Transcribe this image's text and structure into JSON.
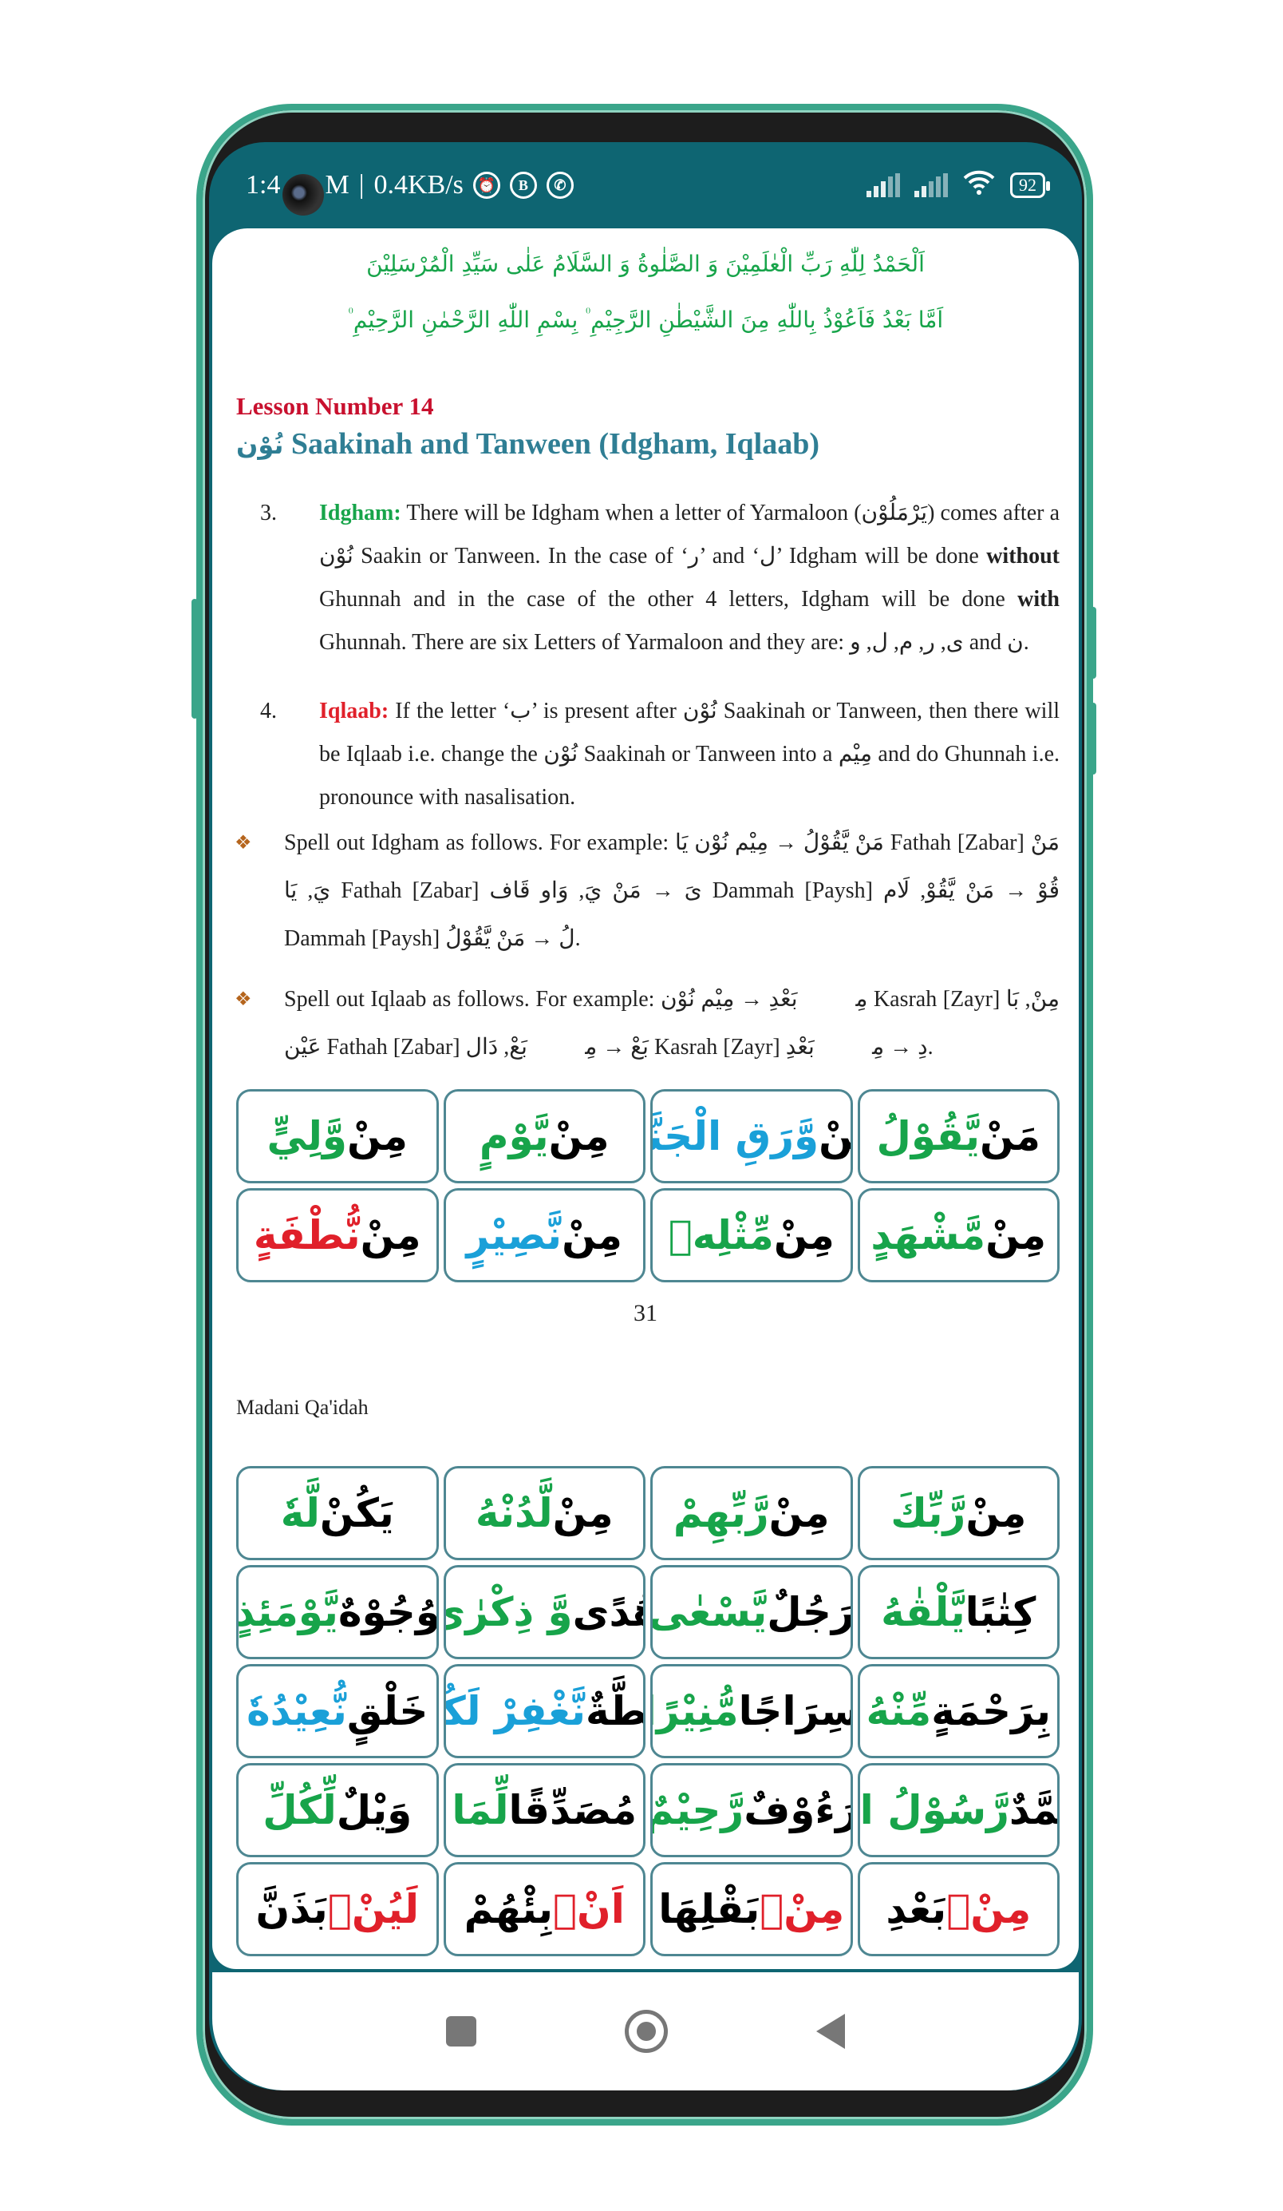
{
  "status_bar": {
    "time": "1:4",
    "time_suffix": "M",
    "net_speed": "0.4KB/s",
    "icons": [
      "alarm-icon",
      "b-icon",
      "whatsapp-icon",
      "signal-icon",
      "signal-icon",
      "wifi-icon"
    ],
    "battery": "92"
  },
  "header": {
    "bismillah_line1": "اَلْحَمْدُ لِلّٰهِ رَبِّ الْعٰلَمِيْنَ وَ الصَّلٰوةُ وَ السَّلَامُ عَلٰى سَيِّدِ الْمُرْسَلِيْنَ",
    "bismillah_line2": "اَمَّا بَعْدُ فَاَعُوْذُ بِاللّٰهِ مِنَ الشَّيْطٰنِ الرَّجِيْمِ ۠ بِسْمِ اللّٰهِ الرَّحْمٰنِ الرَّحِيْمِ ۠",
    "lesson": "Lesson Number 14",
    "title_ar": "نُوْن",
    "title": "Saakinah and Tanween (Idgham, Iqlaab)"
  },
  "paragraphs": [
    {
      "num": "3.",
      "term": "Idgham:",
      "text": "There will be Idgham when a letter of Yarmaloon (يَرْمَلُوْن) comes after a نُوْن Saakin or Tanween. In the case of ‘ر’ and ‘ل’ Idgham will be done <b>without</b> Ghunnah and in the case of the other 4 letters, Idgham will be done <b>with</b> Ghunnah. There are six Letters of Yarmaloon and they are: ی, ر, م, ل, و and ن."
    },
    {
      "num": "4.",
      "term": "Iqlaab:",
      "text": "If the letter ‘ب’ is present after نُوْن Saakinah or Tanween, then there will be Iqlaab i.e. change the نُوْن Saakinah or Tanween into a مِيْم and do Ghunnah i.e. pronounce with nasalisation."
    }
  ],
  "bullets": [
    {
      "text": "Spell out Idgham as follows. For example: مَنْ يَّقُوْلُ → مِيْم نُوْن يَا Fathah [Zabar] مَنْ يَ, يَا Fathah [Zabar] ىَ → مَنْ يَ, وَاو قَاف Dammah [Paysh] قُوْ → مَنْ يَّقُوْ, لَام Dammah [Paysh] لُ → مَنْ يَّقُوْلُ."
    },
    {
      "text": "Spell out Iqlaab as follows. For example: مِنْۢ بَعْدِ → مِيْم نُوْن Kasrah [Zayr] مِنْ, بَا عَيْن Fathah [Zabar] بَعْ → مِنْۢ بَعْ, دَال Kasrah [Zayr] دِ → مِنْۢ بَعْدِ."
    }
  ],
  "table1": [
    [
      {
        "t": "مَنْ ",
        "c": ""
      },
      {
        "t": "يَّقُوْلُ",
        "c": "#17a44a"
      }
    ],
    [
      {
        "t": "مِنْ ",
        "c": ""
      },
      {
        "t": "وَّرَقِ الْجَنَّةِ",
        "c": "#1aa0d8"
      }
    ],
    [
      {
        "t": "مِنْ ",
        "c": ""
      },
      {
        "t": "يَّوْمٍ",
        "c": "#17a44a"
      }
    ],
    [
      {
        "t": "مِنْ ",
        "c": ""
      },
      {
        "t": "وَّلِيٍّ",
        "c": "#17a44a"
      }
    ],
    [
      {
        "t": "مِنْ ",
        "c": ""
      },
      {
        "t": "مَّشْهَدٍ",
        "c": "#17a44a"
      }
    ],
    [
      {
        "t": "مِنْ ",
        "c": ""
      },
      {
        "t": "مِّثْلِهٖ",
        "c": "#17a44a"
      }
    ],
    [
      {
        "t": "مِنْ ",
        "c": ""
      },
      {
        "t": "نَّصِيْرٍ",
        "c": "#1aa0d8"
      }
    ],
    [
      {
        "t": "مِنْ ",
        "c": ""
      },
      {
        "t": "نُّطْفَةٍ",
        "c": "#e0202a"
      }
    ]
  ],
  "page_number": "31",
  "footer_label": "Madani Qa'idah",
  "table2": [
    [
      {
        "t": "مِنْ ",
        "c": ""
      },
      {
        "t": "رَّبِّكَ",
        "c": "#17a44a"
      }
    ],
    [
      {
        "t": "مِنْ ",
        "c": ""
      },
      {
        "t": "رَّبِّهِمْ",
        "c": "#17a44a"
      }
    ],
    [
      {
        "t": "مِنْ ",
        "c": ""
      },
      {
        "t": "لَّدُنْهُ",
        "c": "#17a44a"
      }
    ],
    [
      {
        "t": "يَكُنْ ",
        "c": ""
      },
      {
        "t": "لَّهٗ",
        "c": "#17a44a"
      }
    ],
    [
      {
        "t": "كِتٰبًا ",
        "c": ""
      },
      {
        "t": "يَّلْقٰهُ",
        "c": "#17a44a"
      }
    ],
    [
      {
        "t": "رَجُلٌ ",
        "c": ""
      },
      {
        "t": "يَّسْعٰى",
        "c": "#17a44a"
      }
    ],
    [
      {
        "t": "هُدًى ",
        "c": ""
      },
      {
        "t": "وَّ ذِكْرٰى",
        "c": "#17a44a"
      }
    ],
    [
      {
        "t": "وُجُوْهٌ ",
        "c": ""
      },
      {
        "t": "يَّوْمَئِذٍ",
        "c": "#17a44a"
      }
    ],
    [
      {
        "t": "بِرَحْمَةٍ ",
        "c": ""
      },
      {
        "t": "مِّنْهُ",
        "c": "#17a44a"
      }
    ],
    [
      {
        "t": "سِرَاجًا ",
        "c": ""
      },
      {
        "t": "مُّنِيْرًا",
        "c": "#17a44a"
      }
    ],
    [
      {
        "t": "حِطَّةٌ ",
        "c": ""
      },
      {
        "t": "نَّغْفِرْ لَكُمْ",
        "c": "#1aa0d8"
      }
    ],
    [
      {
        "t": "خَلْقٍ ",
        "c": ""
      },
      {
        "t": "نُّعِيْدُهٗ",
        "c": "#1aa0d8"
      }
    ],
    [
      {
        "t": "مُحَمَّدٌ ",
        "c": ""
      },
      {
        "t": "رَّسُوْلُ اللّٰهِ",
        "c": "#17a44a"
      }
    ],
    [
      {
        "t": "رَءُوْفٌ ",
        "c": ""
      },
      {
        "t": "رَّحِيْمٌ",
        "c": "#17a44a"
      }
    ],
    [
      {
        "t": "مُصَدِّقًا ",
        "c": ""
      },
      {
        "t": "لِّمَا",
        "c": "#17a44a"
      }
    ],
    [
      {
        "t": "وَيْلٌ ",
        "c": ""
      },
      {
        "t": "لِّكُلِّ",
        "c": "#17a44a"
      }
    ],
    [
      {
        "t": "مِنْۢ ",
        "c": "#e0202a"
      },
      {
        "t": "بَعْدِ",
        "c": ""
      }
    ],
    [
      {
        "t": "مِنْۢ ",
        "c": "#e0202a"
      },
      {
        "t": "بَقْلِهَا",
        "c": ""
      }
    ],
    [
      {
        "t": "اَنْۢ",
        "c": "#e0202a"
      },
      {
        "t": "بِئْهُمْ",
        "c": ""
      }
    ],
    [
      {
        "t": "لَيُنْۢ",
        "c": "#e0202a"
      },
      {
        "t": "بَذَنَّ",
        "c": ""
      }
    ]
  ],
  "nav": {
    "icons": [
      "recents-square-icon",
      "home-circle-icon",
      "back-triangle-icon"
    ]
  },
  "colors": {
    "status_bar": "#0e6572",
    "frame": "#3aa58a",
    "idgham": "#17a44a",
    "iqlaab": "#e0202a",
    "title": "#2f7e94",
    "lesson": "#c8102e"
  }
}
